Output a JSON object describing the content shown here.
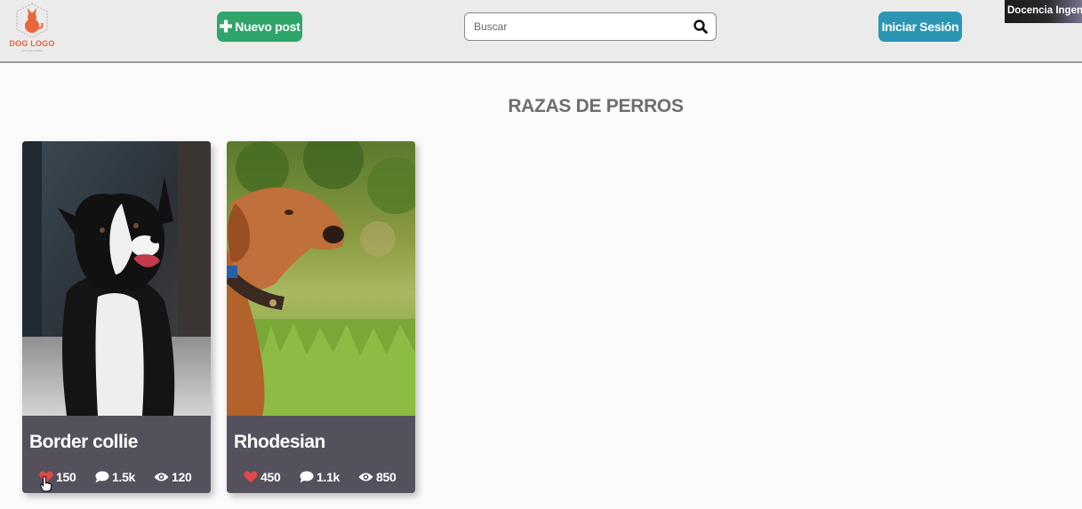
{
  "header": {
    "logo_text": "DOG LOGO",
    "logo_subtext": "lorem ipsum dolor",
    "new_post_label": "Nuevo post",
    "search_placeholder": "Buscar",
    "login_label": "Iniciar Sesión",
    "overlay_label": "Docencia Ingeniería"
  },
  "main": {
    "title": "RAZAS DE PERROS",
    "cards": [
      {
        "name": "Border collie",
        "likes": "150",
        "comments": "1.5k",
        "views": "120"
      },
      {
        "name": "Rhodesian",
        "likes": "450",
        "comments": "1.1k",
        "views": "850"
      }
    ]
  },
  "icons": [
    "plus-icon",
    "search-icon",
    "heart-icon",
    "comment-icon",
    "eye-icon"
  ],
  "colors": {
    "new_post_button": "#2fa56a",
    "login_button": "#2a96b4",
    "logo_accent": "#e8663a",
    "heart": "#e24848",
    "card_footer": "#54515c"
  }
}
